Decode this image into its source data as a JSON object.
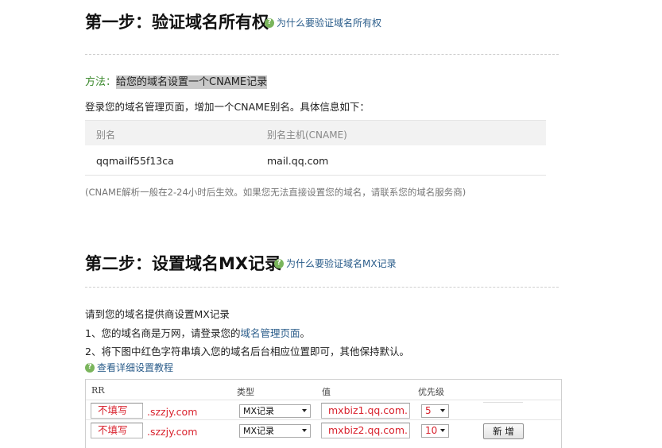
{
  "step1": {
    "title": "第一步：验证域名所有权",
    "why_link": "为什么要验证域名所有权",
    "method_label": "方法：",
    "method_text": "给您的域名设置一个CNAME记录",
    "intro": "登录您的域名管理页面，增加一个CNAME别名。具体信息如下：",
    "table": {
      "headers": [
        "别名",
        "别名主机(CNAME)"
      ],
      "row": [
        "qqmailf55f13ca",
        "mail.qq.com"
      ]
    },
    "note": "(CNAME解析一般在2-24小时后生效。如果您无法直接设置您的域名，请联系您的域名服务商)"
  },
  "step2": {
    "title": "第二步：设置域名MX记录",
    "why_link": "为什么要验证域名MX记录",
    "line1": "请到您的域名提供商设置MX记录",
    "line2_prefix": "1、您的域名商是万网，请登录您的",
    "line2_link": "域名管理页面",
    "line2_suffix": "。",
    "line3": "2、将下图中红色字符串填入您的域名后台相应位置即可，其他保持默认。",
    "tutorial_link": "查看详细设置教程",
    "mx_table": {
      "headers": [
        "RR",
        "类型",
        "值",
        "优先级"
      ],
      "rows": [
        {
          "rr": "不填写",
          "domain": ".szzjy.com",
          "type": "MX记录",
          "value": "mxbiz1.qq.com.",
          "priority": "5"
        },
        {
          "rr": "不填写",
          "domain": ".szzjy.com",
          "type": "MX记录",
          "value": "mxbiz2.qq.com.",
          "priority": "10"
        }
      ],
      "add_button": "新 增"
    }
  },
  "colors": {
    "accent_link": "#2a5c8a",
    "method_green": "#3c8a2e",
    "red_value": "#d9232e",
    "help_icon": "#7ab55c"
  },
  "icons": [
    "help-circle-icon",
    "chevron-down-icon"
  ]
}
